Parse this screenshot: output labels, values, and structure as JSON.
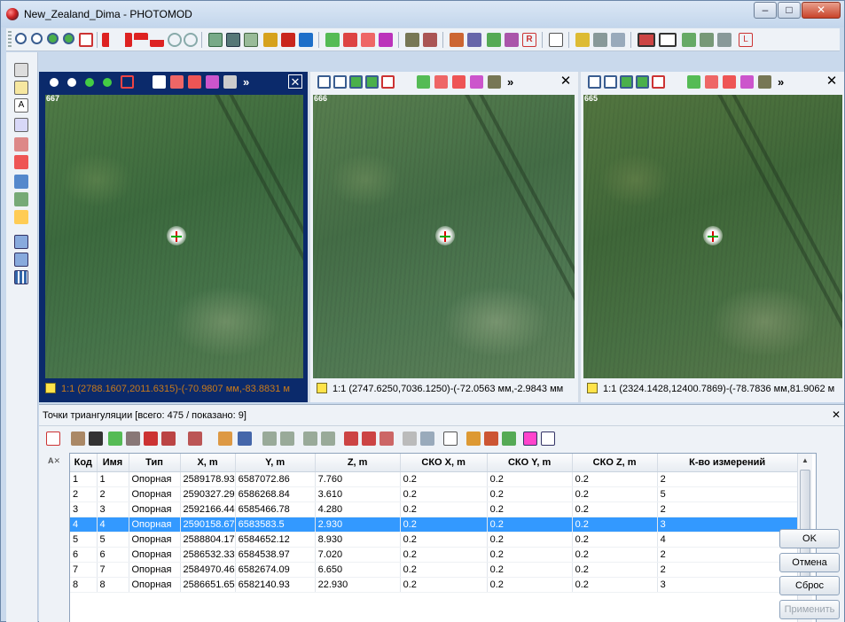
{
  "window": {
    "title": "New_Zealand_Dima - PHOTOMOD",
    "minimize": "–",
    "maximize": "□",
    "close": "✕"
  },
  "colors": {
    "selection": "#3399ff",
    "panel_active_bg": "#0b2a6b",
    "status_active_text": "#c97a1a"
  },
  "panels": [
    {
      "image_id": "667",
      "status": "1:1 (2788.1607,2011.6315)-(-70.9807 мм,-83.8831 м",
      "more": "»",
      "close": "✕"
    },
    {
      "image_id": "666",
      "status": "1:1 (2747.6250,7036.1250)-(-72.0563 мм,-2.9843 мм",
      "more": "»",
      "close": "✕"
    },
    {
      "image_id": "665",
      "status": "1:1 (2324.1428,12400.7869)-(-78.7836 мм,81.9062 м",
      "more": "»",
      "close": "✕"
    }
  ],
  "triangulation": {
    "title": "Точки триангуляции [всего: 475 / показано: 9]",
    "close": "✕",
    "columns": [
      "Код",
      "Имя",
      "Тип",
      "X, m",
      "Y, m",
      "Z, m",
      "СКО X, m",
      "СКО Y, m",
      "СКО Z, m",
      "К-во измерений"
    ],
    "rows": [
      [
        "1",
        "1",
        "Опорная",
        "2589178.93",
        "6587072.86",
        "7.760",
        "0.2",
        "0.2",
        "0.2",
        "2"
      ],
      [
        "2",
        "2",
        "Опорная",
        "2590327.29",
        "6586268.84",
        "3.610",
        "0.2",
        "0.2",
        "0.2",
        "5"
      ],
      [
        "3",
        "3",
        "Опорная",
        "2592166.44",
        "6585466.78",
        "4.280",
        "0.2",
        "0.2",
        "0.2",
        "2"
      ],
      [
        "4",
        "4",
        "Опорная",
        "2590158.67",
        "6583583.5",
        "2.930",
        "0.2",
        "0.2",
        "0.2",
        "3"
      ],
      [
        "5",
        "5",
        "Опорная",
        "2588804.17",
        "6584652.12",
        "8.930",
        "0.2",
        "0.2",
        "0.2",
        "4"
      ],
      [
        "6",
        "6",
        "Опорная",
        "2586532.33",
        "6584538.97",
        "7.020",
        "0.2",
        "0.2",
        "0.2",
        "2"
      ],
      [
        "7",
        "7",
        "Опорная",
        "2584970.46",
        "6582674.09",
        "6.650",
        "0.2",
        "0.2",
        "0.2",
        "2"
      ],
      [
        "8",
        "8",
        "Опорная",
        "2586651.65",
        "6582140.93",
        "22.930",
        "0.2",
        "0.2",
        "0.2",
        "3"
      ]
    ],
    "selected_row": 3,
    "buttons": {
      "ok": "OK",
      "cancel": "Отмена",
      "reset": "Сброс",
      "apply": "Применить"
    }
  },
  "icons": {
    "main_toolbar": [
      "zoom-in-icon",
      "zoom-out-icon",
      "zoom-fit-icon",
      "zoom-1to1-icon",
      "zoom-window-icon",
      "arrow-left-icon",
      "arrow-right-icon",
      "arrow-up-icon",
      "arrow-down-icon",
      "undo-icon",
      "redo-icon"
    ],
    "left_toolbar": [
      "pointer-icon",
      "measure-icon",
      "text-icon",
      "link-icon",
      "point-icon",
      "point-red-icon",
      "filter-icon",
      "multi-icon",
      "delta-icon",
      "window-icon",
      "window2-icon",
      "grid-icon"
    ]
  }
}
